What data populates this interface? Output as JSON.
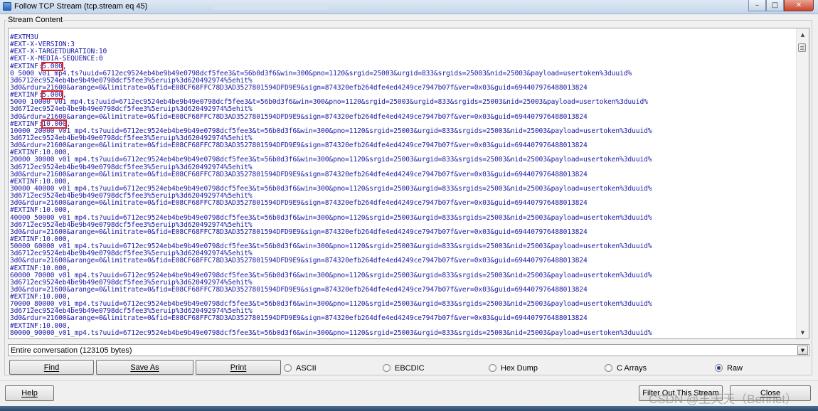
{
  "window": {
    "title": "Follow TCP Stream (tcp.stream eq 45)",
    "controls": [
      "minimize-icon",
      "maximize-icon",
      "close-icon"
    ]
  },
  "group_label": "Stream Content",
  "stream": {
    "lines": [
      "#EXTM3U",
      "#EXT-X-VERSION:3",
      "#EXT-X-TARGETDURATION:10",
      "#EXT-X-MEDIA-SEQUENCE:0",
      "#EXTINF:5.000,",
      "0_5000_v01_mp4.ts?uuid=6712ec9524eb4be9b49e0798dcf5fee3&t=56b0d3f6&win=300&pno=1120&srgid=25003&urgid=833&srgids=25003&nid=25003&payload=usertoken%3duuid%",
      "3d6712ec9524eb4be9b49e0798dcf5fee3%5eruip%3d620492974%5ehit%",
      "3d0&rdur=21600&arange=0&limitrate=0&fid=E08CF68FFC78D3AD3527801594DFD9E9&sign=874320efb264dfe4ed4249ce7947b07f&ver=0x03&guid=694407976488013824",
      "#EXTINF:5.000,",
      "5000_10000_v01_mp4.ts?uuid=6712ec9524eb4be9b49e0798dcf5fee3&t=56b0d3f6&win=300&pno=1120&srgid=25003&urgid=833&srgids=25003&nid=25003&payload=usertoken%3duuid%",
      "3d6712ec9524eb4be9b49e0798dcf5fee3%5eruip%3d620492974%5ehit%",
      "3d0&rdur=21600&arange=0&limitrate=0&fid=E08CF68FFC78D3AD3527801594DFD9E9&sign=874320efb264dfe4ed4249ce7947b07f&ver=0x03&guid=694407976488013824",
      "#EXTINF:10.000,",
      "10000_20000_v01_mp4.ts?uuid=6712ec9524eb4be9b49e0798dcf5fee3&t=56b0d3f6&win=300&pno=1120&srgid=25003&urgid=833&srgids=25003&nid=25003&payload=usertoken%3duuid%",
      "3d6712ec9524eb4be9b49e0798dcf5fee3%5eruip%3d620492974%5ehit%",
      "3d0&rdur=21600&arange=0&limitrate=0&fid=E08CF68FFC78D3AD3527801594DFD9E9&sign=874320efb264dfe4ed4249ce7947b07f&ver=0x03&guid=694407976488013824",
      "#EXTINF:10.000,",
      "20000_30000_v01_mp4.ts?uuid=6712ec9524eb4be9b49e0798dcf5fee3&t=56b0d3f6&win=300&pno=1120&srgid=25003&urgid=833&srgids=25003&nid=25003&payload=usertoken%3duuid%",
      "3d6712ec9524eb4be9b49e0798dcf5fee3%5eruip%3d620492974%5ehit%",
      "3d0&rdur=21600&arange=0&limitrate=0&fid=E08CF68FFC78D3AD3527801594DFD9E9&sign=874320efb264dfe4ed4249ce7947b07f&ver=0x03&guid=694407976488013824",
      "#EXTINF:10.000,",
      "30000_40000_v01_mp4.ts?uuid=6712ec9524eb4be9b49e0798dcf5fee3&t=56b0d3f6&win=300&pno=1120&srgid=25003&urgid=833&srgids=25003&nid=25003&payload=usertoken%3duuid%",
      "3d6712ec9524eb4be9b49e0798dcf5fee3%5eruip%3d620492974%5ehit%",
      "3d0&rdur=21600&arange=0&limitrate=0&fid=E08CF68FFC78D3AD3527801594DFD9E9&sign=874320efb264dfe4ed4249ce7947b07f&ver=0x03&guid=694407976488013824",
      "#EXTINF:10.000,",
      "40000_50000_v01_mp4.ts?uuid=6712ec9524eb4be9b49e0798dcf5fee3&t=56b0d3f6&win=300&pno=1120&srgid=25003&urgid=833&srgids=25003&nid=25003&payload=usertoken%3duuid%",
      "3d6712ec9524eb4be9b49e0798dcf5fee3%5eruip%3d620492974%5ehit%",
      "3d0&rdur=21600&arange=0&limitrate=0&fid=E08CF68FFC78D3AD3527801594DFD9E9&sign=874320efb264dfe4ed4249ce7947b07f&ver=0x03&guid=694407976488013824",
      "#EXTINF:10.000,",
      "50000_60000_v01_mp4.ts?uuid=6712ec9524eb4be9b49e0798dcf5fee3&t=56b0d3f6&win=300&pno=1120&srgid=25003&urgid=833&srgids=25003&nid=25003&payload=usertoken%3duuid%",
      "3d6712ec9524eb4be9b49e0798dcf5fee3%5eruip%3d620492974%5ehit%",
      "3d0&rdur=21600&arange=0&limitrate=0&fid=E08CF68FFC78D3AD3527801594DFD9E9&sign=874320efb264dfe4ed4249ce7947b07f&ver=0x03&guid=694407976488013824",
      "#EXTINF:10.000,",
      "60000_70000_v01_mp4.ts?uuid=6712ec9524eb4be9b49e0798dcf5fee3&t=56b0d3f6&win=300&pno=1120&srgid=25003&urgid=833&srgids=25003&nid=25003&payload=usertoken%3duuid%",
      "3d6712ec9524eb4be9b49e0798dcf5fee3%5eruip%3d620492974%5ehit%",
      "3d0&rdur=21600&arange=0&limitrate=0&fid=E08CF68FFC78D3AD3527801594DFD9E9&sign=874320efb264dfe4ed4249ce7947b07f&ver=0x03&guid=694407976488013824",
      "#EXTINF:10.000,",
      "70000_80000_v01_mp4.ts?uuid=6712ec9524eb4be9b49e0798dcf5fee3&t=56b0d3f6&win=300&pno=1120&srgid=25003&urgid=833&srgids=25003&nid=25003&payload=usertoken%3duuid%",
      "3d6712ec9524eb4be9b49e0798dcf5fee3%5eruip%3d620492974%5ehit%",
      "3d0&rdur=21600&arange=0&limitrate=0&fid=E08CF68FFC78D3AD3527801594DFD9E9&sign=874320efb264dfe4ed4249ce7947b07f&ver=0x03&guid=694407976488013824",
      "#EXTINF:10.000,",
      "80000_90000_v01_mp4.ts?uuid=6712ec9524eb4be9b49e0798dcf5fee3&t=56b0d3f6&win=300&pno=1120&srgid=25003&urgid=833&srgids=25003&nid=25003&payload=usertoken%3duuid%"
    ],
    "highlights": [
      {
        "line": 4,
        "text": "5.000"
      },
      {
        "line": 8,
        "text": "5.000"
      },
      {
        "line": 12,
        "text": "10.000"
      }
    ],
    "highlight_color": "#e02020",
    "text_color": "#1a1aa6"
  },
  "conversation_select": {
    "value": "Entire conversation (123105 bytes)"
  },
  "buttons": {
    "find": "Find",
    "save_as": "Save As",
    "print": "Print",
    "help": "Help",
    "filter_out": "Filter Out This Stream",
    "close": "Close"
  },
  "format": {
    "options": [
      {
        "id": "ascii",
        "label": "ASCII"
      },
      {
        "id": "ebcdic",
        "label": "EBCDIC"
      },
      {
        "id": "hex-dump",
        "label": "Hex Dump"
      },
      {
        "id": "c-arrays",
        "label": "C Arrays"
      },
      {
        "id": "raw",
        "label": "Raw"
      }
    ],
    "selected": "raw"
  },
  "watermark": "CSDN @王天天（Bennet）"
}
